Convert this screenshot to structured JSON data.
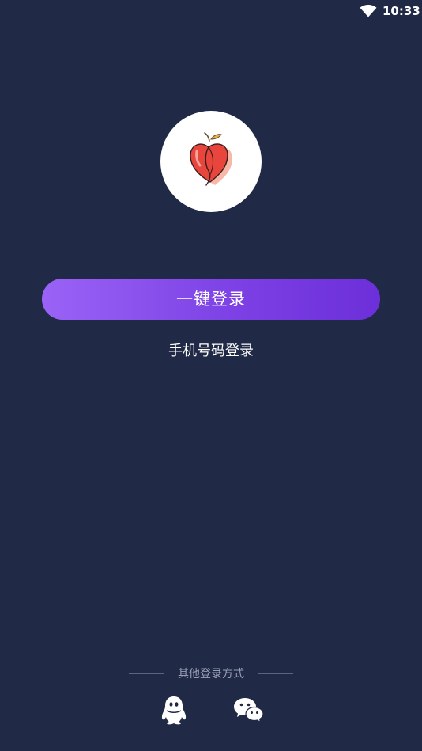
{
  "status_bar": {
    "time": "10:33",
    "wifi_icon": "wifi-icon"
  },
  "logo": {
    "icon": "peach-icon",
    "accent_color": "#e8453c"
  },
  "login": {
    "one_click_label": "一键登录",
    "phone_login_label": "手机号码登录",
    "button_gradient": [
      "#9a63f6",
      "#6c2fd9"
    ]
  },
  "other_methods": {
    "label": "其他登录方式",
    "options": [
      {
        "icon": "qq-icon"
      },
      {
        "icon": "wechat-icon"
      }
    ]
  },
  "theme": {
    "background": "#202946"
  }
}
